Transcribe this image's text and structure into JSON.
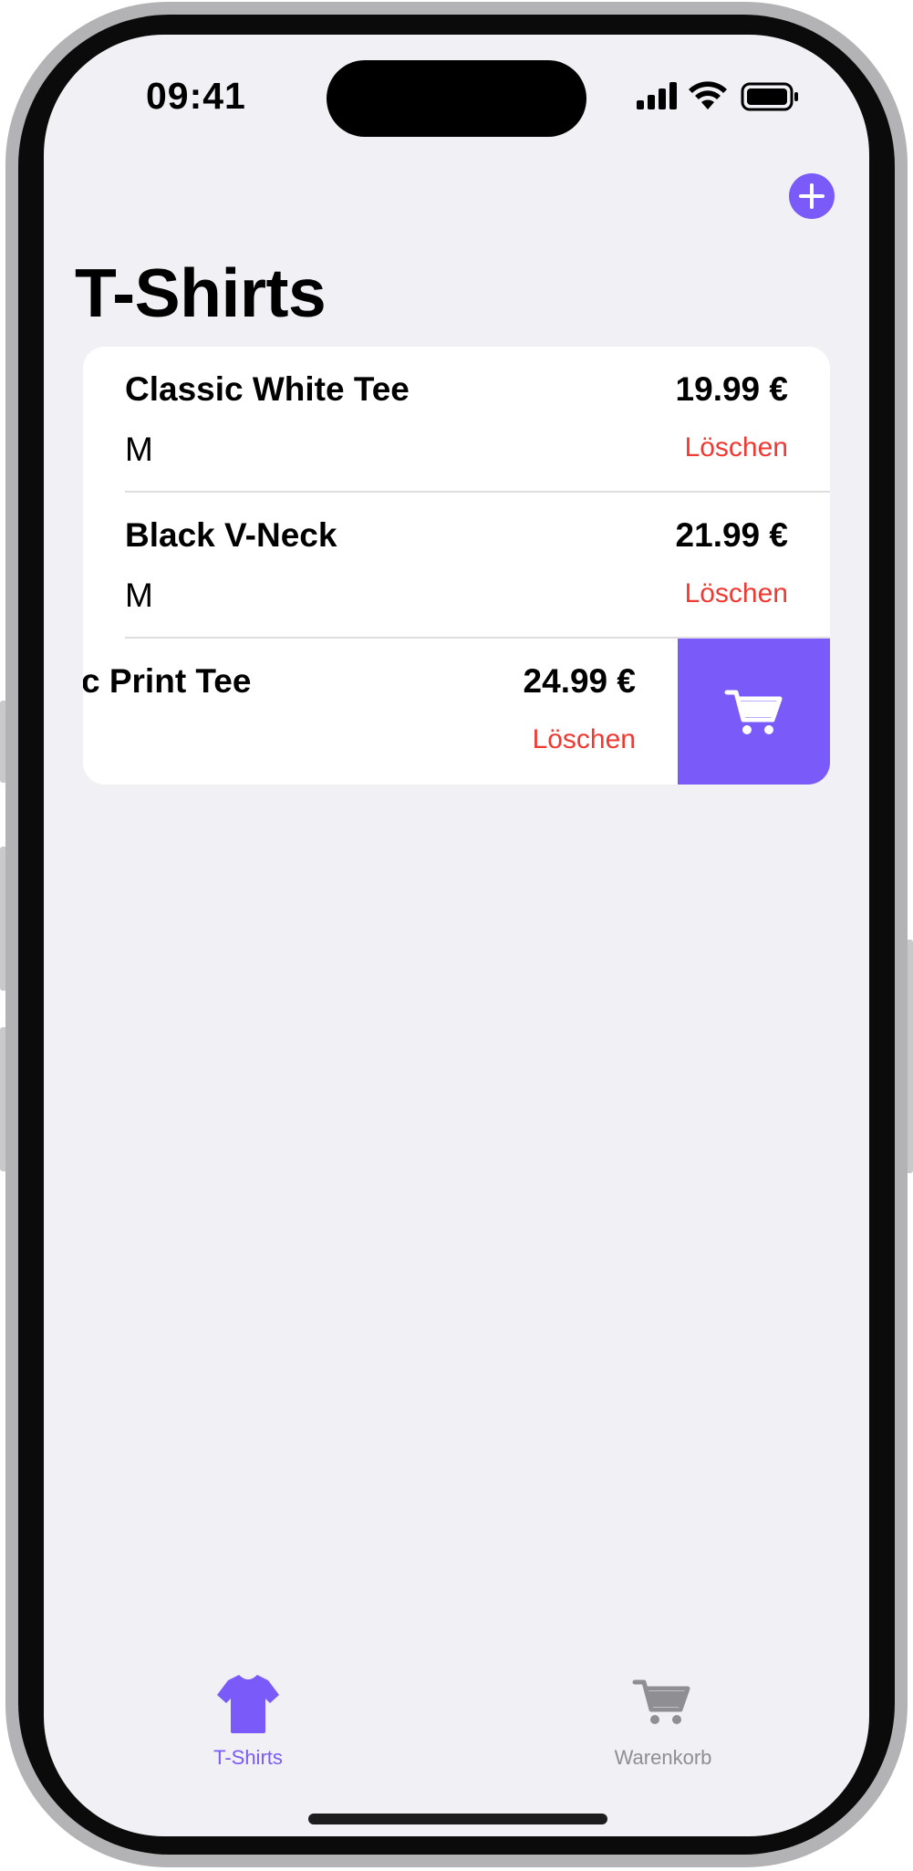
{
  "status_bar": {
    "time": "09:41"
  },
  "nav": {
    "title": "T-Shirts",
    "add_icon": "plus-icon"
  },
  "items": [
    {
      "name": "Classic White Tee",
      "price": "19.99 €",
      "size": "M",
      "delete_label": "Löschen"
    },
    {
      "name": "Black V-Neck",
      "price": "21.99 €",
      "size": "M",
      "delete_label": "Löschen"
    },
    {
      "name": "c Print Tee",
      "price": "24.99 €",
      "size": "",
      "delete_label": "Löschen"
    }
  ],
  "swipe_action": {
    "icon": "cart-icon"
  },
  "tabs": [
    {
      "label": "T-Shirts",
      "icon": "tshirt-icon",
      "active": true
    },
    {
      "label": "Warenkorb",
      "icon": "cart-icon",
      "active": false
    }
  ],
  "colors": {
    "accent": "#7a5af8",
    "destructive": "#ee3a33",
    "background": "#f1f1f5",
    "inactive_tab": "#8e8e93"
  }
}
